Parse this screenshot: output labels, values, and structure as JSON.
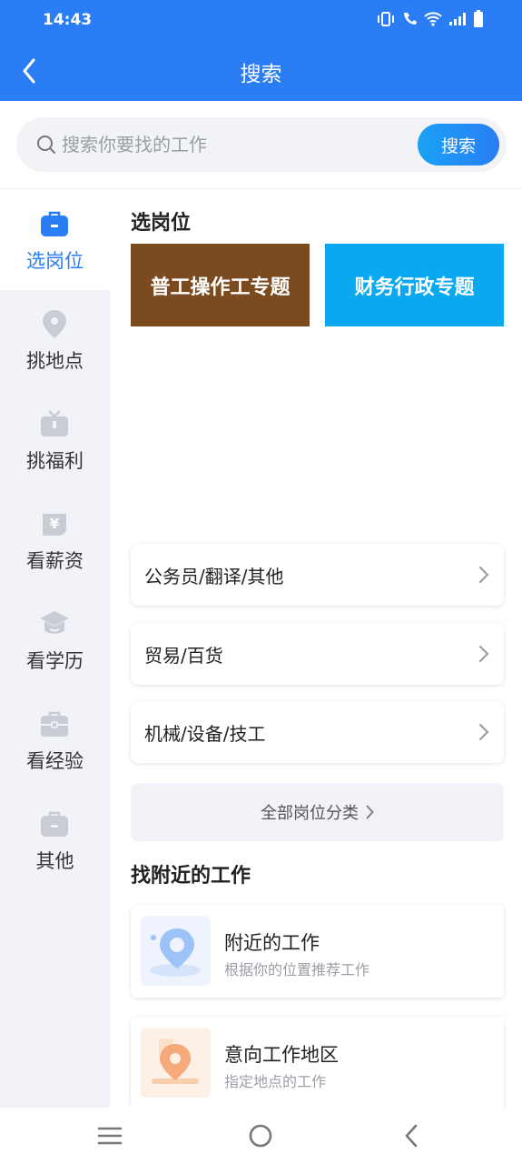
{
  "status": {
    "time": "14:43"
  },
  "header": {
    "title": "搜索"
  },
  "search": {
    "placeholder": "搜索你要找的工作",
    "button_label": "搜索"
  },
  "sidebar": {
    "items": [
      {
        "label": "选岗位",
        "icon": "briefcase-icon",
        "active": true
      },
      {
        "label": "挑地点",
        "icon": "location-pin-icon"
      },
      {
        "label": "挑福利",
        "icon": "gift-icon"
      },
      {
        "label": "看薪资",
        "icon": "yen-icon"
      },
      {
        "label": "看学历",
        "icon": "graduation-cap-icon"
      },
      {
        "label": "看经验",
        "icon": "toolbox-icon"
      },
      {
        "label": "其他",
        "icon": "bag-icon"
      }
    ]
  },
  "main": {
    "section1_title": "选岗位",
    "topics": [
      {
        "label": "普工操作工专题",
        "color": "#7b4a1f"
      },
      {
        "label": "财务行政专题",
        "color": "#0aa8f0"
      }
    ],
    "categories": [
      {
        "label": "公务员/翻译/其他"
      },
      {
        "label": "贸易/百货"
      },
      {
        "label": "机械/设备/技工"
      }
    ],
    "all_categories_label": "全部岗位分类",
    "section2_title": "找附近的工作",
    "nearby": [
      {
        "title": "附近的工作",
        "subtitle": "根据你的位置推荐工作",
        "icon": "location-pin-icon"
      },
      {
        "title": "意向工作地区",
        "subtitle": "指定地点的工作",
        "icon": "location-pin-icon"
      }
    ]
  },
  "colors": {
    "primary": "#2a7df4",
    "sidebar_bg": "#f1f3f8"
  }
}
